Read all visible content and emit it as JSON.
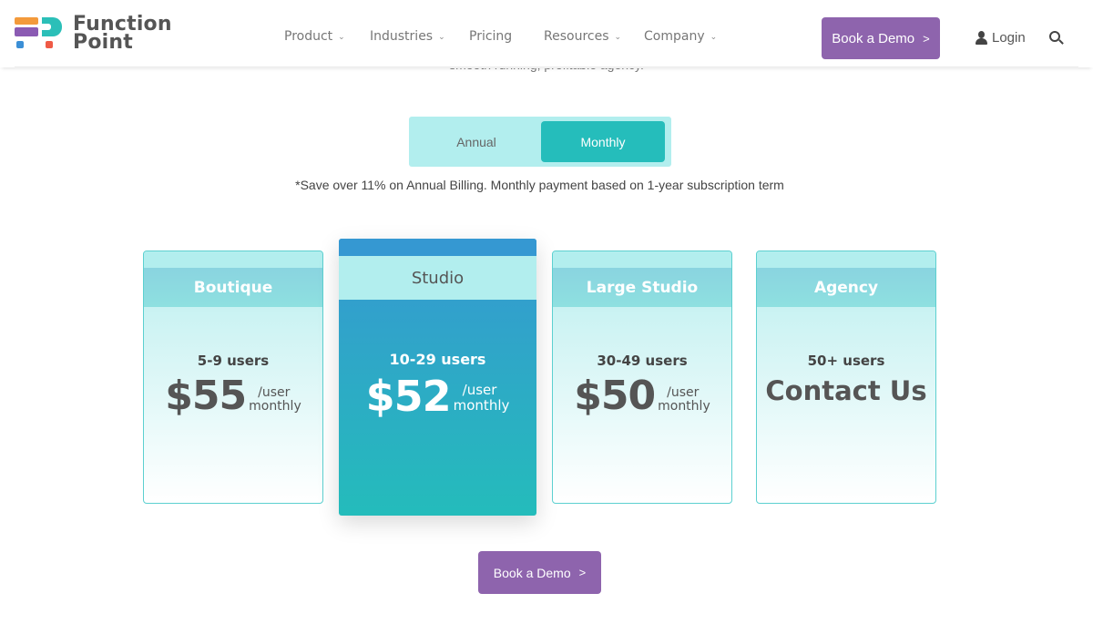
{
  "brand": {
    "line1": "Function",
    "line2": "Point"
  },
  "nav": {
    "items": [
      {
        "label": "Product",
        "has_dropdown": true
      },
      {
        "label": "Industries",
        "has_dropdown": true
      },
      {
        "label": "Pricing",
        "has_dropdown": false
      },
      {
        "label": "Resources",
        "has_dropdown": true
      },
      {
        "label": "Company",
        "has_dropdown": true
      }
    ],
    "demo_button": "Book a Demo",
    "demo_arrow": ">",
    "login": "Login",
    "chevron": "⌄"
  },
  "hero": {
    "cut_text": "smooth running, profitable agency."
  },
  "billing_toggle": {
    "options": [
      "Annual",
      "Monthly"
    ],
    "selected": "Monthly"
  },
  "note": "*Save over 11% on Annual Billing. Monthly payment based on 1-year subscription term",
  "plans": [
    {
      "name": "Boutique",
      "users": "5-9 users",
      "price": "$55",
      "per1": "/user",
      "per2": "monthly"
    },
    {
      "name": "Studio",
      "users": "10-29 users",
      "price": "$52",
      "per1": "/user",
      "per2": "monthly",
      "featured": true
    },
    {
      "name": "Large Studio",
      "users": "30-49 users",
      "price": "$50",
      "per1": "/user",
      "per2": "monthly"
    },
    {
      "name": "Agency",
      "users": "50+ users",
      "contact": "Contact Us"
    }
  ],
  "cta": {
    "label": "Book a Demo",
    "arrow": ">"
  },
  "colors": {
    "accent_purple": "#8e64ad",
    "teal": "#25bdbb",
    "light_teal": "#b2eeee",
    "featured_blue": "#3598d2"
  }
}
